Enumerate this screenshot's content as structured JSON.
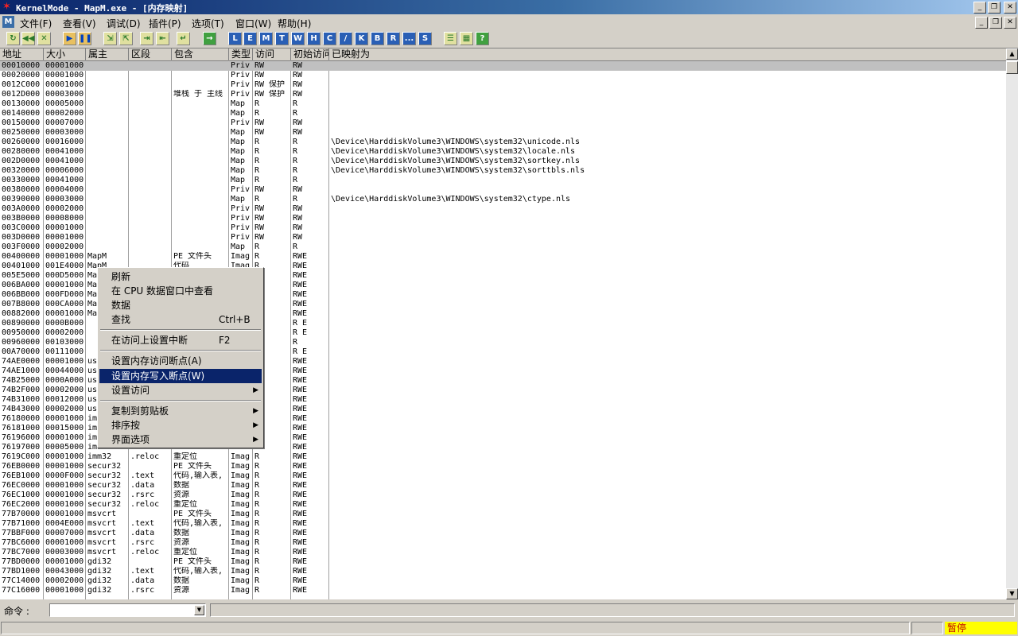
{
  "window": {
    "title": "KernelMode - MapM.exe - [内存映射]",
    "buttons": [
      "_",
      "❐",
      "✕"
    ]
  },
  "menubar": {
    "logo": "M",
    "items": [
      "文件(F)",
      "查看(V)",
      "调试(D)",
      "插件(P)",
      "选项(T)",
      "窗口(W)",
      "帮助(H)"
    ],
    "mdi_buttons": [
      "_",
      "❐",
      "✕"
    ]
  },
  "toolbar": {
    "buttons": [
      {
        "glyph": "↻",
        "icon": "open-icon",
        "style": "g"
      },
      {
        "glyph": "◀◀",
        "icon": "restart-icon",
        "style": "g"
      },
      {
        "glyph": "✕",
        "icon": "close-process-icon",
        "style": "g"
      },
      {
        "glyph": "▶",
        "icon": "run-icon",
        "style": "y"
      },
      {
        "glyph": "❚❚",
        "icon": "pause-icon",
        "style": "y"
      },
      {
        "glyph": "⇲",
        "icon": "step-into-icon",
        "style": "g"
      },
      {
        "glyph": "⇱",
        "icon": "step-over-icon",
        "style": "g"
      },
      {
        "glyph": "⇥",
        "icon": "trace-into-icon",
        "style": "g"
      },
      {
        "glyph": "⇤",
        "icon": "trace-over-icon",
        "style": "g"
      },
      {
        "glyph": "↵",
        "icon": "execute-till-return-icon",
        "style": "g"
      },
      {
        "glyph": "→",
        "icon": "goto-icon",
        "style": "gr"
      },
      {
        "glyph": "L",
        "icon": "log-window-icon",
        "style": "l"
      },
      {
        "glyph": "E",
        "icon": "modules-window-icon",
        "style": "l"
      },
      {
        "glyph": "M",
        "icon": "memory-window-icon",
        "style": "l"
      },
      {
        "glyph": "T",
        "icon": "threads-window-icon",
        "style": "l"
      },
      {
        "glyph": "W",
        "icon": "windows-window-icon",
        "style": "l"
      },
      {
        "glyph": "H",
        "icon": "handles-window-icon",
        "style": "l"
      },
      {
        "glyph": "C",
        "icon": "cpu-window-icon",
        "style": "l"
      },
      {
        "glyph": "/",
        "icon": "patches-window-icon",
        "style": "l"
      },
      {
        "glyph": "K",
        "icon": "call-stack-window-icon",
        "style": "l"
      },
      {
        "glyph": "B",
        "icon": "breakpoints-window-icon",
        "style": "l"
      },
      {
        "glyph": "R",
        "icon": "references-window-icon",
        "style": "l"
      },
      {
        "glyph": "...",
        "icon": "run-trace-window-icon",
        "style": "l"
      },
      {
        "glyph": "S",
        "icon": "source-window-icon",
        "style": "l"
      },
      {
        "glyph": "☰",
        "icon": "list-icon",
        "style": "g"
      },
      {
        "glyph": "▦",
        "icon": "options-icon",
        "style": "g"
      },
      {
        "glyph": "?",
        "icon": "help-icon",
        "style": "gr"
      }
    ]
  },
  "table": {
    "columns": [
      "地址",
      "大小",
      "属主",
      "区段",
      "包含",
      "类型",
      "访问",
      "初始访问",
      "已映射为"
    ],
    "rows": [
      [
        "00010000",
        "00001000",
        "",
        "",
        "",
        "Priv",
        "RW",
        "RW",
        ""
      ],
      [
        "00020000",
        "00001000",
        "",
        "",
        "",
        "Priv",
        "RW",
        "RW",
        ""
      ],
      [
        "0012C000",
        "00001000",
        "",
        "",
        "",
        "Priv",
        "RW  保护",
        "RW",
        ""
      ],
      [
        "0012D000",
        "00003000",
        "",
        "",
        "堆栈 于 主线",
        "Priv",
        "RW  保护",
        "RW",
        ""
      ],
      [
        "00130000",
        "00005000",
        "",
        "",
        "",
        "Map",
        "R",
        "R",
        ""
      ],
      [
        "00140000",
        "00002000",
        "",
        "",
        "",
        "Map",
        "R",
        "R",
        ""
      ],
      [
        "00150000",
        "00007000",
        "",
        "",
        "",
        "Priv",
        "RW",
        "RW",
        ""
      ],
      [
        "00250000",
        "00003000",
        "",
        "",
        "",
        "Map",
        "RW",
        "RW",
        ""
      ],
      [
        "00260000",
        "00016000",
        "",
        "",
        "",
        "Map",
        "R",
        "R",
        "\\Device\\HarddiskVolume3\\WINDOWS\\system32\\unicode.nls"
      ],
      [
        "00280000",
        "00041000",
        "",
        "",
        "",
        "Map",
        "R",
        "R",
        "\\Device\\HarddiskVolume3\\WINDOWS\\system32\\locale.nls"
      ],
      [
        "002D0000",
        "00041000",
        "",
        "",
        "",
        "Map",
        "R",
        "R",
        "\\Device\\HarddiskVolume3\\WINDOWS\\system32\\sortkey.nls"
      ],
      [
        "00320000",
        "00006000",
        "",
        "",
        "",
        "Map",
        "R",
        "R",
        "\\Device\\HarddiskVolume3\\WINDOWS\\system32\\sorttbls.nls"
      ],
      [
        "00330000",
        "00041000",
        "",
        "",
        "",
        "Map",
        "R",
        "R",
        ""
      ],
      [
        "00380000",
        "00004000",
        "",
        "",
        "",
        "Priv",
        "RW",
        "RW",
        ""
      ],
      [
        "00390000",
        "00003000",
        "",
        "",
        "",
        "Map",
        "R",
        "R",
        "\\Device\\HarddiskVolume3\\WINDOWS\\system32\\ctype.nls"
      ],
      [
        "003A0000",
        "00002000",
        "",
        "",
        "",
        "Priv",
        "RW",
        "RW",
        ""
      ],
      [
        "003B0000",
        "00008000",
        "",
        "",
        "",
        "Priv",
        "RW",
        "RW",
        ""
      ],
      [
        "003C0000",
        "00001000",
        "",
        "",
        "",
        "Priv",
        "RW",
        "RW",
        ""
      ],
      [
        "003D0000",
        "00001000",
        "",
        "",
        "",
        "Priv",
        "RW",
        "RW",
        ""
      ],
      [
        "003F0000",
        "00002000",
        "",
        "",
        "",
        "Map",
        "R",
        "R",
        ""
      ],
      [
        "00400000",
        "00001000",
        "MapM",
        "",
        "PE 文件头",
        "Imag",
        "R",
        "RWE",
        ""
      ],
      [
        "00401000",
        "001E4000",
        "MapM",
        "",
        "代码",
        "Imag",
        "R",
        "RWE",
        ""
      ],
      [
        "005E5000",
        "000D5000",
        "Ma",
        "",
        "",
        "",
        "",
        "RWE",
        ""
      ],
      [
        "006BA000",
        "00001000",
        "Ma",
        "",
        "",
        "",
        "",
        "RWE",
        ""
      ],
      [
        "006BB000",
        "000FD000",
        "Ma",
        "",
        "",
        "",
        "",
        "RWE",
        ""
      ],
      [
        "007B8000",
        "000CA000",
        "Ma",
        "",
        "",
        "",
        "",
        "RWE",
        ""
      ],
      [
        "00882000",
        "00001000",
        "Ma",
        "",
        "",
        "",
        "",
        "RWE",
        ""
      ],
      [
        "00890000",
        "0000B000",
        "",
        "",
        "",
        "",
        "E",
        "R E",
        ""
      ],
      [
        "00950000",
        "00002000",
        "",
        "",
        "",
        "",
        "E",
        "R E",
        ""
      ],
      [
        "00960000",
        "00103000",
        "",
        "",
        "",
        "",
        "",
        "R",
        ""
      ],
      [
        "00A70000",
        "00111000",
        "",
        "",
        "",
        "",
        "E",
        "R E",
        ""
      ],
      [
        "74AE0000",
        "00001000",
        "us",
        "",
        "",
        "",
        "",
        "RWE",
        ""
      ],
      [
        "74AE1000",
        "00044000",
        "us",
        "",
        "",
        "",
        "",
        "RWE",
        ""
      ],
      [
        "74B25000",
        "0000A000",
        "us",
        "",
        "",
        "",
        "",
        "RWE",
        ""
      ],
      [
        "74B2F000",
        "00002000",
        "us",
        "",
        "",
        "",
        "",
        "RWE",
        ""
      ],
      [
        "74B31000",
        "00012000",
        "us",
        "",
        "",
        "",
        "",
        "RWE",
        ""
      ],
      [
        "74B43000",
        "00002000",
        "us",
        "",
        "",
        "",
        "",
        "RWE",
        ""
      ],
      [
        "76180000",
        "00001000",
        "im",
        "",
        "",
        "",
        "",
        "RWE",
        ""
      ],
      [
        "76181000",
        "00015000",
        "im",
        "",
        "",
        "",
        "",
        "RWE",
        ""
      ],
      [
        "76196000",
        "00001000",
        "im",
        "",
        "",
        "",
        "",
        "RWE",
        ""
      ],
      [
        "76197000",
        "00005000",
        "im",
        "",
        "",
        "",
        "",
        "RWE",
        ""
      ],
      [
        "7619C000",
        "00001000",
        "imm32",
        ".reloc",
        "重定位",
        "Imag",
        "R",
        "RWE",
        ""
      ],
      [
        "76EB0000",
        "00001000",
        "secur32",
        "",
        "PE 文件头",
        "Imag",
        "R",
        "RWE",
        ""
      ],
      [
        "76EB1000",
        "0000F000",
        "secur32",
        ".text",
        "代码,输入表,",
        "Imag",
        "R",
        "RWE",
        ""
      ],
      [
        "76EC0000",
        "00001000",
        "secur32",
        ".data",
        "数据",
        "Imag",
        "R",
        "RWE",
        ""
      ],
      [
        "76EC1000",
        "00001000",
        "secur32",
        ".rsrc",
        "资源",
        "Imag",
        "R",
        "RWE",
        ""
      ],
      [
        "76EC2000",
        "00001000",
        "secur32",
        ".reloc",
        "重定位",
        "Imag",
        "R",
        "RWE",
        ""
      ],
      [
        "77B70000",
        "00001000",
        "msvcrt",
        "",
        "PE 文件头",
        "Imag",
        "R",
        "RWE",
        ""
      ],
      [
        "77B71000",
        "0004E000",
        "msvcrt",
        ".text",
        "代码,输入表,",
        "Imag",
        "R",
        "RWE",
        ""
      ],
      [
        "77BBF000",
        "00007000",
        "msvcrt",
        ".data",
        "数据",
        "Imag",
        "R",
        "RWE",
        ""
      ],
      [
        "77BC6000",
        "00001000",
        "msvcrt",
        ".rsrc",
        "资源",
        "Imag",
        "R",
        "RWE",
        ""
      ],
      [
        "77BC7000",
        "00003000",
        "msvcrt",
        ".reloc",
        "重定位",
        "Imag",
        "R",
        "RWE",
        ""
      ],
      [
        "77BD0000",
        "00001000",
        "gdi32",
        "",
        "PE 文件头",
        "Imag",
        "R",
        "RWE",
        ""
      ],
      [
        "77BD1000",
        "00043000",
        "gdi32",
        ".text",
        "代码,输入表,",
        "Imag",
        "R",
        "RWE",
        ""
      ],
      [
        "77C14000",
        "00002000",
        "gdi32",
        ".data",
        "数据",
        "Imag",
        "R",
        "RWE",
        ""
      ],
      [
        "77C16000",
        "00001000",
        "gdi32",
        ".rsrc",
        "资源",
        "Imag",
        "R",
        "RWE",
        ""
      ]
    ]
  },
  "context_menu": {
    "items": [
      {
        "label": "刷新",
        "shortcut": "",
        "arrow": ""
      },
      {
        "label": "在 CPU 数据窗口中查看",
        "shortcut": "",
        "arrow": ""
      },
      {
        "label": "数据",
        "shortcut": "",
        "arrow": ""
      },
      {
        "label": "查找",
        "shortcut": "Ctrl+B",
        "arrow": ""
      },
      {
        "label": "在访问上设置中断",
        "shortcut": "F2",
        "arrow": ""
      },
      {
        "label": "设置内存访问断点(A)",
        "shortcut": "",
        "arrow": ""
      },
      {
        "label": "设置内存写入断点(W)",
        "shortcut": "",
        "arrow": ""
      },
      {
        "label": "设置访问",
        "shortcut": "",
        "arrow": "▶"
      },
      {
        "label": "复制到剪贴板",
        "shortcut": "",
        "arrow": "▶"
      },
      {
        "label": "排序按",
        "shortcut": "",
        "arrow": "▶"
      },
      {
        "label": "界面选项",
        "shortcut": "",
        "arrow": "▶"
      }
    ]
  },
  "command": {
    "label": "命令 :",
    "value": ""
  },
  "status": {
    "state": "暂停"
  }
}
